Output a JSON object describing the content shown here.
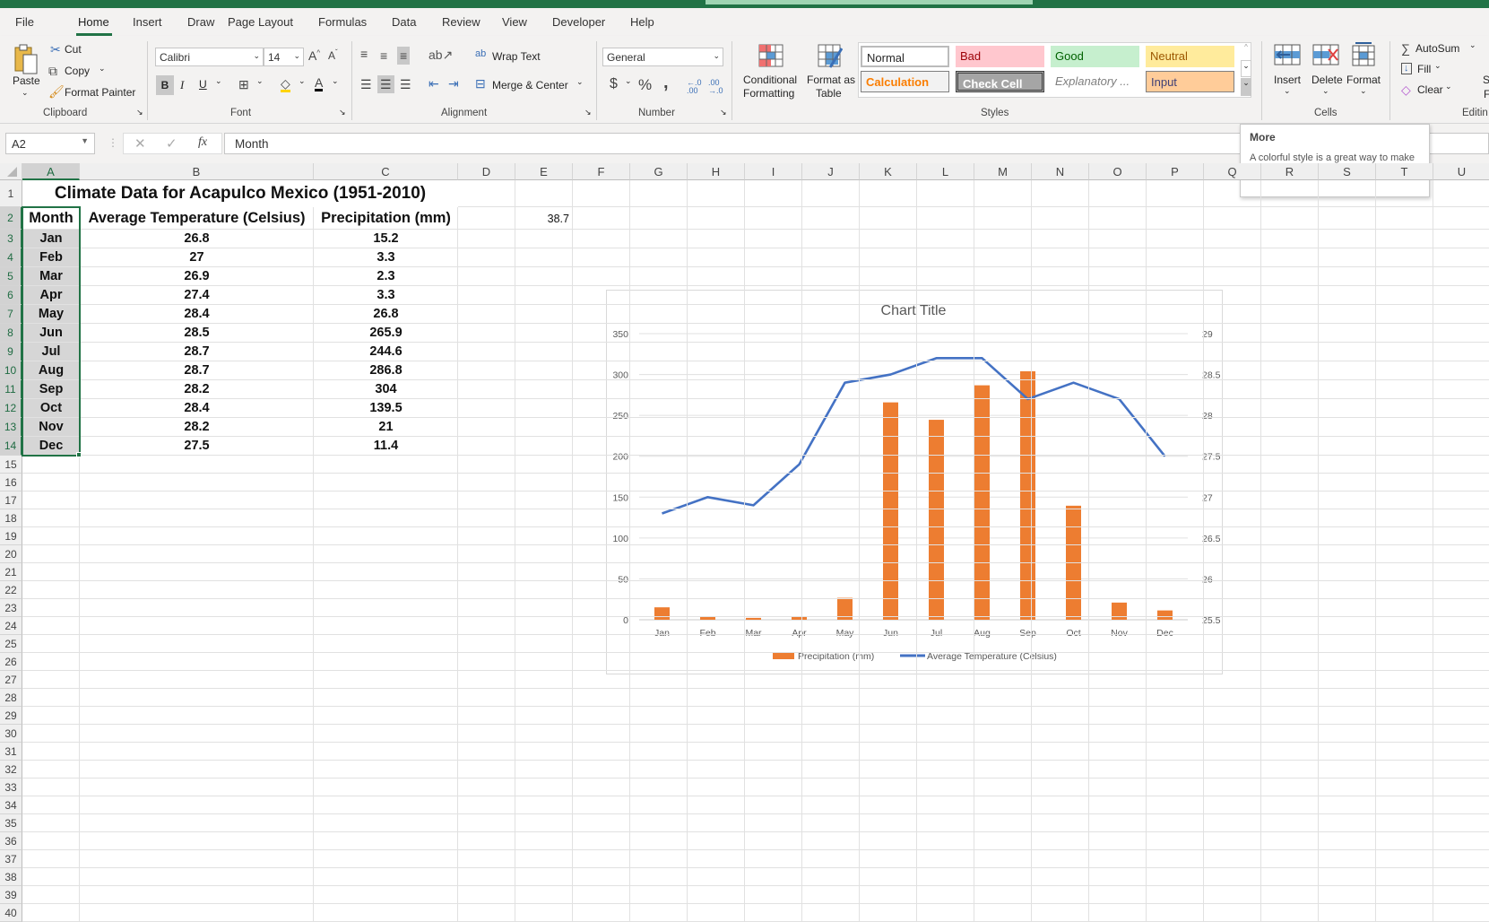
{
  "menu": {
    "tabs": [
      "File",
      "Home",
      "Insert",
      "Draw",
      "Page Layout",
      "Formulas",
      "Data",
      "Review",
      "View",
      "Developer",
      "Help"
    ],
    "active": "Home"
  },
  "ribbon": {
    "clipboard": {
      "paste": "Paste",
      "cut": "Cut",
      "copy": "Copy",
      "format_painter": "Format Painter",
      "label": "Clipboard"
    },
    "font": {
      "name": "Calibri",
      "size": "14",
      "bold": "B",
      "italic": "I",
      "underline": "U",
      "label": "Font"
    },
    "alignment": {
      "wrap_text": "Wrap Text",
      "merge_center": "Merge & Center",
      "label": "Alignment"
    },
    "number": {
      "format": "General",
      "currency": "$",
      "percent": "%",
      "comma": ",",
      "label": "Number"
    },
    "styles": {
      "conditional_1": "Conditional",
      "conditional_2": "Formatting",
      "format_table_1": "Format as",
      "format_table_2": "Table",
      "gallery": [
        {
          "name": "Normal",
          "bg": "#ffffff",
          "fg": "#222222"
        },
        {
          "name": "Bad",
          "bg": "#ffc7ce",
          "fg": "#9c0006"
        },
        {
          "name": "Good",
          "bg": "#c6efce",
          "fg": "#006100"
        },
        {
          "name": "Neutral",
          "bg": "#ffeb9c",
          "fg": "#9c5700"
        },
        {
          "name": "Calculation",
          "bg": "#f2f2f2",
          "fg": "#fa7d00"
        },
        {
          "name": "Check Cell",
          "bg": "#a5a5a5",
          "fg": "#ffffff"
        },
        {
          "name": "Explanatory ...",
          "bg": "#ffffff",
          "fg": "#7f7f7f"
        },
        {
          "name": "Input",
          "bg": "#ffcc99",
          "fg": "#3f3f76"
        }
      ],
      "label": "Styles"
    },
    "cells": {
      "insert": "Insert",
      "delete": "Delete",
      "format": "Format",
      "label": "Cells"
    },
    "editing": {
      "autosum": "AutoSum",
      "fill": "Fill",
      "clear": "Clear",
      "label": "Editin",
      "cut_s": "S",
      "cut_f": "F"
    }
  },
  "formula_bar": {
    "name_box": "A2",
    "fx": "fx",
    "value": "Month"
  },
  "tooltip": {
    "title": "More",
    "body": "A colorful style is a great way to make important data stand out on the sheet."
  },
  "sheet": {
    "columns": [
      "A",
      "B",
      "C",
      "D",
      "E",
      "F",
      "G",
      "H",
      "I",
      "J",
      "K",
      "L",
      "M",
      "N",
      "O",
      "P",
      "Q",
      "R",
      "S",
      "T",
      "U"
    ],
    "title": "Climate Data for Acapulco Mexico (1951-2010)",
    "headers": [
      "Month",
      "Average Temperature (Celsius)",
      "Precipitation (mm)"
    ],
    "rows": [
      [
        "Jan",
        "26.8",
        "15.2"
      ],
      [
        "Feb",
        "27",
        "3.3"
      ],
      [
        "Mar",
        "26.9",
        "2.3"
      ],
      [
        "Apr",
        "27.4",
        "3.3"
      ],
      [
        "May",
        "28.4",
        "26.8"
      ],
      [
        "Jun",
        "28.5",
        "265.9"
      ],
      [
        "Jul",
        "28.7",
        "244.6"
      ],
      [
        "Aug",
        "28.7",
        "286.8"
      ],
      [
        "Sep",
        "28.2",
        "304"
      ],
      [
        "Oct",
        "28.4",
        "139.5"
      ],
      [
        "Nov",
        "28.2",
        "21"
      ],
      [
        "Dec",
        "27.5",
        "11.4"
      ]
    ],
    "e2": "38.7",
    "selected_range": "A2:A14"
  },
  "chart_data": {
    "type": "bar+line",
    "title": "Chart Title",
    "categories": [
      "Jan",
      "Feb",
      "Mar",
      "Apr",
      "May",
      "Jun",
      "Jul",
      "Aug",
      "Sep",
      "Oct",
      "Nov",
      "Dec"
    ],
    "series": [
      {
        "name": "Precipitation (mm)",
        "type": "bar",
        "axis": "left",
        "color": "#ed7d31",
        "values": [
          15.2,
          3.3,
          2.3,
          3.3,
          26.8,
          265.9,
          244.6,
          286.8,
          304,
          139.5,
          21,
          11.4
        ]
      },
      {
        "name": "Average Temperature (Celsius)",
        "type": "line",
        "axis": "right",
        "color": "#4472c4",
        "values": [
          26.8,
          27,
          26.9,
          27.4,
          28.4,
          28.5,
          28.7,
          28.7,
          28.2,
          28.4,
          28.2,
          27.5
        ]
      }
    ],
    "left_axis": {
      "min": 0,
      "max": 350,
      "step": 50,
      "ticks": [
        "0",
        "50",
        "100",
        "150",
        "200",
        "250",
        "300",
        "350"
      ]
    },
    "right_axis": {
      "min": 25.5,
      "max": 29,
      "step": 0.5,
      "ticks": [
        "25.5",
        "26",
        "26.5",
        "27",
        "27.5",
        "28",
        "28.5",
        "29"
      ]
    },
    "grid": true,
    "legend": "bottom"
  }
}
